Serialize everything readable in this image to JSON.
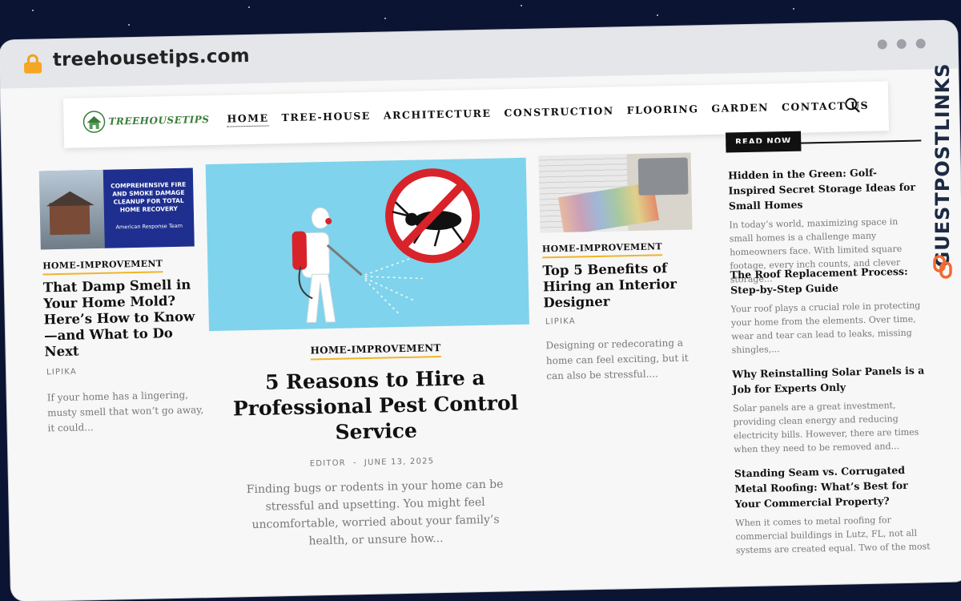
{
  "browser": {
    "url": "treehousetips.com"
  },
  "site": {
    "logo_text": "TREEHOUSETIPS",
    "nav": [
      "HOME",
      "TREE-HOUSE",
      "ARCHITECTURE",
      "CONSTRUCTION",
      "FLOORING",
      "GARDEN",
      "CONTACT US"
    ],
    "active_nav": "HOME"
  },
  "left_card": {
    "image_headline": "COMPREHENSIVE FIRE AND SMOKE DAMAGE CLEANUP FOR TOTAL HOME RECOVERY",
    "image_caption": "American Response Team",
    "tag": "HOME-IMPROVEMENT",
    "title": "That Damp Smell in Your Home Mold? Here’s How to Know—and What to Do Next",
    "author": "LIPIKA",
    "excerpt": "If your home has a lingering, musty smell that won’t go away, it could..."
  },
  "featured": {
    "tag": "HOME-IMPROVEMENT",
    "title": "5 Reasons to Hire a Professional Pest Control Service",
    "author": "EDITOR",
    "separator": "-",
    "date": "JUNE 13, 2025",
    "excerpt": "Finding bugs or rodents in your home can be stressful and upsetting. You might feel uncomfortable, worried about your family’s health, or unsure how..."
  },
  "right_card": {
    "tag": "HOME-IMPROVEMENT",
    "title": "Top 5 Benefits of Hiring an Interior Designer",
    "author": "LIPIKA",
    "excerpt": "Designing or redecorating a home can feel exciting, but it can also be stressful...."
  },
  "sidebar": {
    "heading": "READ NOW",
    "items": [
      {
        "title": "Hidden in the Green: Golf-Inspired Secret Storage Ideas for Small Homes",
        "excerpt": "In today’s world, maximizing space in small homes is a challenge many homeowners face. With limited square footage, every inch counts, and clever storage..."
      },
      {
        "title": "The Roof Replacement Process: Step-by-Step Guide",
        "excerpt": "Your roof plays a crucial role in protecting your home from the elements. Over time, wear and tear can lead to leaks, missing shingles,..."
      },
      {
        "title": "Why Reinstalling Solar Panels is a Job for Experts Only",
        "excerpt": "Solar panels are a great investment, providing clean energy and reducing electricity bills. However, there are times when they need to be removed and..."
      },
      {
        "title": "Standing Seam vs. Corrugated Metal Roofing: What’s Best for Your Commercial Property?",
        "excerpt": "When it comes to metal roofing for commercial buildings in Lutz, FL, not all systems are created equal. Two of the most"
      }
    ]
  },
  "watermark": "GUESTPOSTLINKS",
  "colors": {
    "accent_tag_underline": "#f0b429",
    "sky_blue": "#7fd3ec",
    "pest_red": "#d8232a",
    "card_navy": "#1e2f8f",
    "brand_orange": "#f26a2e"
  }
}
